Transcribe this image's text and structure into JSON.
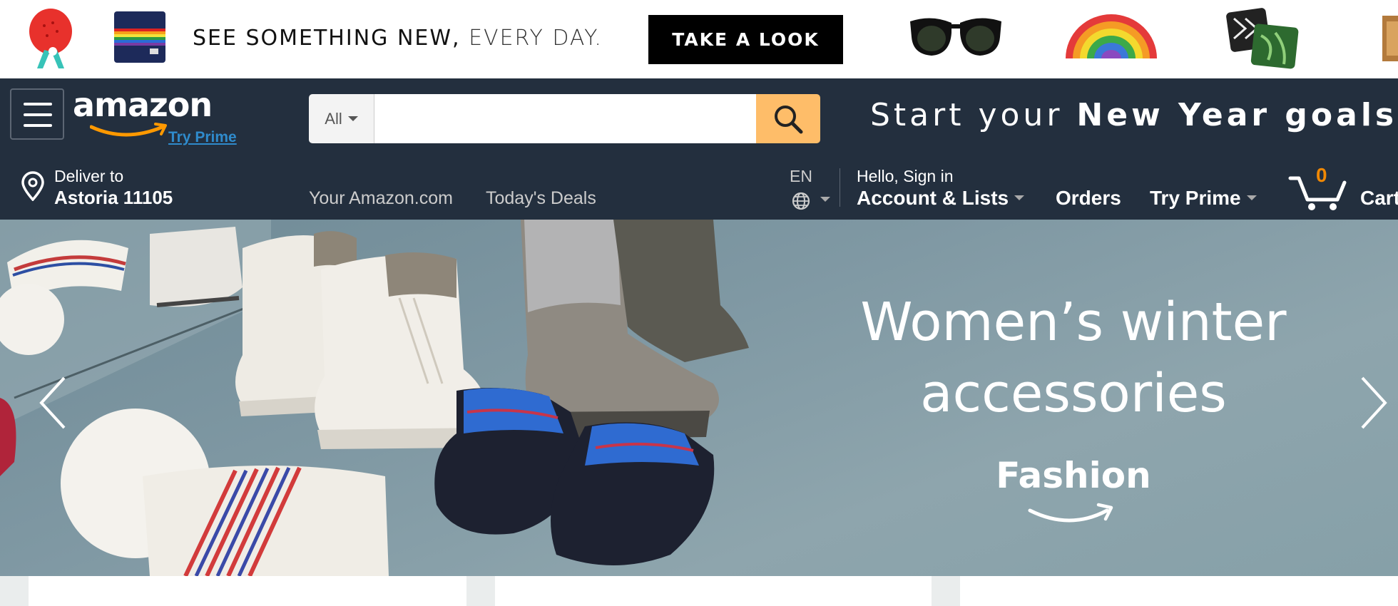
{
  "promo": {
    "text_bold": "SEE SOMETHING NEW,",
    "text_light": "EVERY DAY.",
    "cta_label": "TAKE A LOOK"
  },
  "header": {
    "logo_text": "amazon",
    "logo_prime": "Try Prime",
    "search": {
      "category": "All",
      "placeholder": ""
    },
    "banner_text_normal": "Start your ",
    "banner_text_bold": "New Year goals",
    "deliver": {
      "line1": "Deliver to",
      "line2": "Astoria 11105"
    },
    "links": [
      "Your Amazon.com",
      "Today's Deals"
    ],
    "language": "EN",
    "account": {
      "line1": "Hello, Sign in",
      "line2": "Account & Lists"
    },
    "orders": "Orders",
    "try_prime": "Try Prime",
    "cart": {
      "count": "0",
      "label": "Cart"
    }
  },
  "hero": {
    "title_line1": "Women’s winter",
    "title_line2": "accessories",
    "brand": "Fashion"
  },
  "colors": {
    "nav_bg": "#232f3e",
    "search_button": "#febd69",
    "cart_count": "#f08804",
    "prime_link": "#2f8bcc"
  }
}
